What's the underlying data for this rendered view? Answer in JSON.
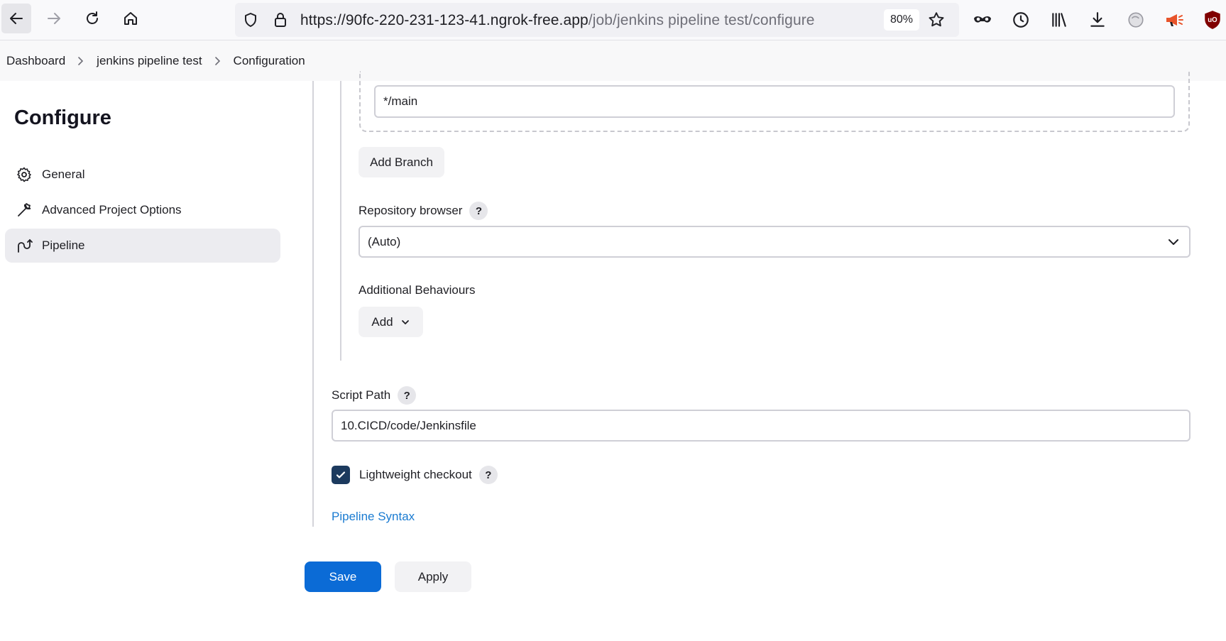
{
  "browser": {
    "url_host": "https://90fc-220-231-123-41.ngrok-free.app",
    "url_path": "/job/jenkins pipeline test/configure",
    "zoom": "80%"
  },
  "breadcrumb": {
    "items": [
      "Dashboard",
      "jenkins pipeline test",
      "Configuration"
    ]
  },
  "sidebar": {
    "title": "Configure",
    "items": [
      {
        "label": "General",
        "icon": "gear-icon"
      },
      {
        "label": "Advanced Project Options",
        "icon": "wrench-icon"
      },
      {
        "label": "Pipeline",
        "icon": "pipeline-icon",
        "active": true
      }
    ]
  },
  "form": {
    "branch_specifier_value": "*/main",
    "add_branch_label": "Add Branch",
    "repository_browser_label": "Repository browser",
    "repository_browser_value": "(Auto)",
    "additional_behaviours_label": "Additional Behaviours",
    "add_label": "Add",
    "script_path_label": "Script Path",
    "script_path_value": "10.CICD/code/Jenkinsfile",
    "lightweight_checkout_label": "Lightweight checkout",
    "lightweight_checkout_checked": true,
    "pipeline_syntax_link": "Pipeline Syntax",
    "help_glyph": "?"
  },
  "actions": {
    "save_label": "Save",
    "apply_label": "Apply"
  },
  "colors": {
    "primary": "#0b6bd6",
    "link": "#1a7bd1",
    "checkbox": "#1c3a5e"
  }
}
